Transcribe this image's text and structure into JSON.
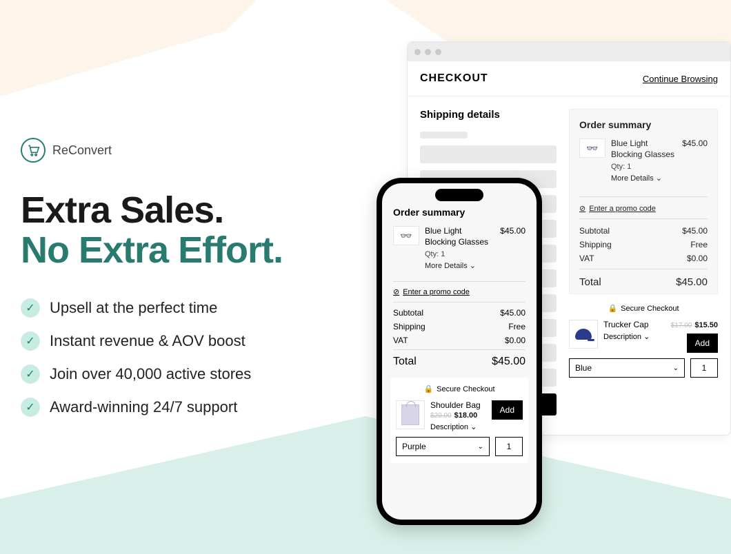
{
  "brand": {
    "name": "ReConvert"
  },
  "headline": {
    "line1": "Extra Sales.",
    "line2": "No Extra Effort."
  },
  "benefits": [
    "Upsell at the perfect time",
    "Instant revenue & AOV boost",
    "Join over 40,000 active stores",
    "Award-winning 24/7 support"
  ],
  "browser": {
    "checkout_title": "CHECKOUT",
    "continue": "Continue Browsing",
    "shipping_title": "Shipping details"
  },
  "summary": {
    "title": "Order summary",
    "item": {
      "name": "Blue Light Blocking Glasses",
      "qty": "Qty: 1",
      "more": "More Details ⌄",
      "price": "$45.00"
    },
    "promo": "Enter a promo code",
    "subtotal_label": "Subtotal",
    "subtotal": "$45.00",
    "shipping_label": "Shipping",
    "shipping": "Free",
    "vat_label": "VAT",
    "vat": "$0.00",
    "total_label": "Total",
    "total": "$45.00",
    "secure": "Secure Checkout"
  },
  "upsell_desktop": {
    "name": "Trucker Cap",
    "price_old": "$17.00",
    "price_new": "$15.50",
    "desc": "Description ⌄",
    "add": "Add",
    "variant": "Blue",
    "qty": "1"
  },
  "upsell_phone": {
    "name": "Shoulder Bag",
    "price_old": "$20.00",
    "price_new": "$18.00",
    "desc": "Description ⌄",
    "add": "Add",
    "variant": "Purple",
    "qty": "1"
  }
}
